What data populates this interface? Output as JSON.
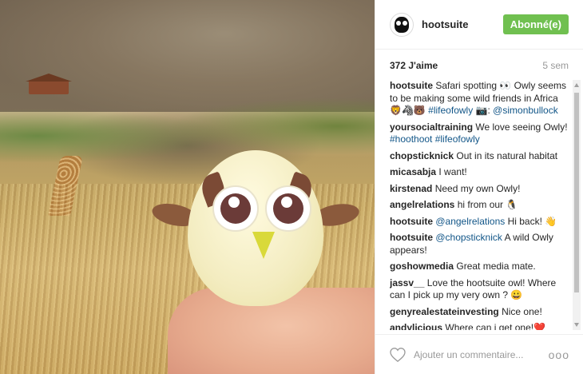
{
  "post": {
    "username": "hootsuite",
    "follow_label": "Abonné(e)",
    "likes": "372 J'aime",
    "age": "5 sem"
  },
  "comments": [
    {
      "user": "hootsuite",
      "text": "Safari spotting 👀 Owly seems to be making some wild friends in Africa 🦁🦓🐻",
      "tag": "#lifeofowly",
      "tail": "📷:",
      "mention": "@simonbullock"
    },
    {
      "user": "yoursocialtraining",
      "text": "We love seeing Owly!",
      "tag": "#hoothoot #lifeofowly"
    },
    {
      "user": "chopsticknick",
      "text": "Out in its natural habitat"
    },
    {
      "user": "micasabja",
      "text": "I want!"
    },
    {
      "user": "kirstenad",
      "text": "Need my own Owly!"
    },
    {
      "user": "angelrelations",
      "text": "hi from our 🐧"
    },
    {
      "user": "hootsuite",
      "mention": "@angelrelations",
      "text": "Hi back! 👋"
    },
    {
      "user": "hootsuite",
      "mention": "@chopsticknick",
      "text": "A wild Owly appears!"
    },
    {
      "user": "goshowmedia",
      "text": "Great media mate."
    },
    {
      "user": "jassv__",
      "text": "Love the hootsuite owl! Where can I pick up my very own ? 😀"
    },
    {
      "user": "genyrealestateinvesting",
      "text": "Nice one!"
    },
    {
      "user": "andylicious",
      "text": "Where can i get one!❤️"
    }
  ],
  "footer": {
    "add_comment_placeholder": "Ajouter un commentaire...",
    "more_label": "ooo"
  }
}
